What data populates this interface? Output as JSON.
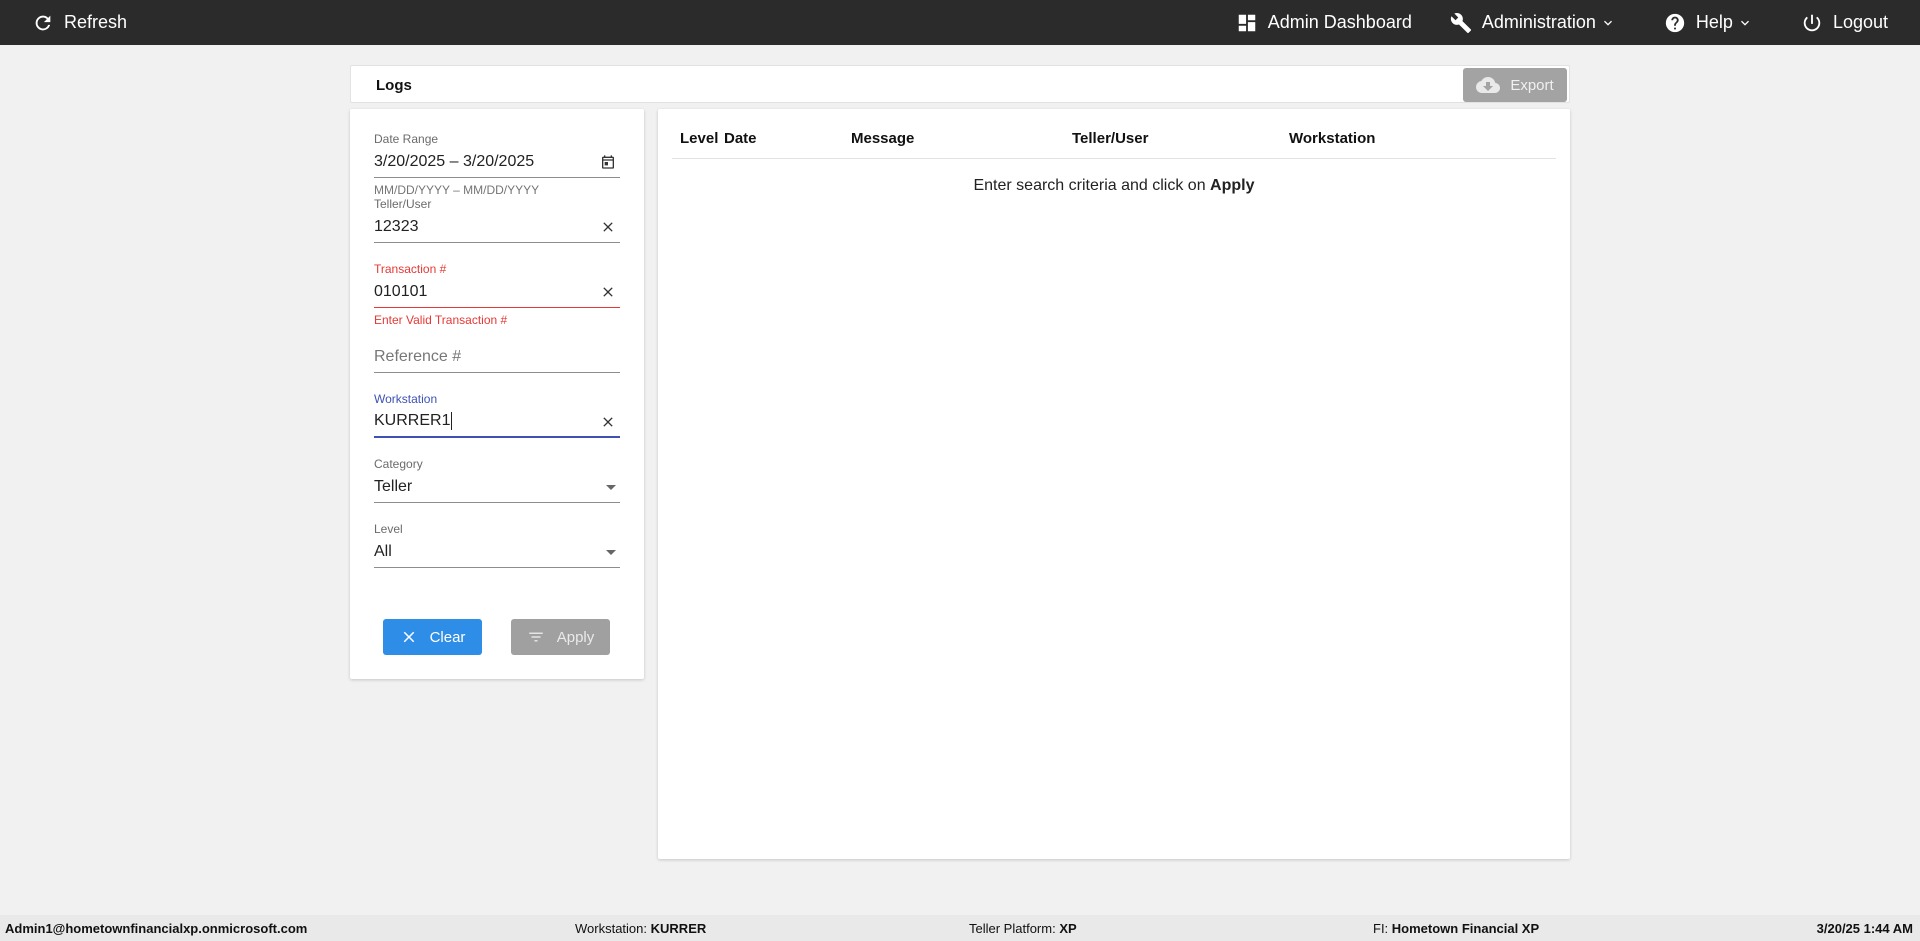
{
  "topbar": {
    "refresh_label": "Refresh",
    "admin_dashboard_label": "Admin Dashboard",
    "administration_label": "Administration",
    "help_label": "Help",
    "logout_label": "Logout"
  },
  "logs": {
    "title": "Logs",
    "export_label": "Export"
  },
  "filters": {
    "date_range": {
      "label": "Date Range",
      "value": "3/20/2025 – 3/20/2025",
      "hint": "MM/DD/YYYY – MM/DD/YYYY"
    },
    "teller_user": {
      "label": "Teller/User",
      "value": "12323"
    },
    "transaction": {
      "label": "Transaction #",
      "value": "010101",
      "error": "Enter Valid Transaction #"
    },
    "reference": {
      "placeholder": "Reference #"
    },
    "workstation": {
      "label": "Workstation",
      "value": "KURRER1"
    },
    "category": {
      "label": "Category",
      "value": "Teller"
    },
    "level": {
      "label": "Level",
      "value": "All"
    },
    "clear_label": "Clear",
    "apply_label": "Apply"
  },
  "table": {
    "columns": [
      "Level",
      "Date",
      "Message",
      "Teller/User",
      "Workstation"
    ],
    "empty_text": "Enter search criteria and click on",
    "empty_bold": "Apply"
  },
  "statusbar": {
    "user": "Admin1@hometownfinancialxp.onmicrosoft.com",
    "workstation_label": "Workstation:",
    "workstation_value": "KURRER",
    "platform_label": "Teller Platform:",
    "platform_value": "XP",
    "fi_label": "FI:",
    "fi_value": "Hometown Financial XP",
    "datetime": "3/20/25 1:44 AM"
  },
  "colors": {
    "topbar_bg": "#2b2b2b",
    "clear_button": "#2e8de6",
    "disabled_button": "#a0a0a0",
    "error": "#e53935",
    "focus": "#3f51b5"
  }
}
